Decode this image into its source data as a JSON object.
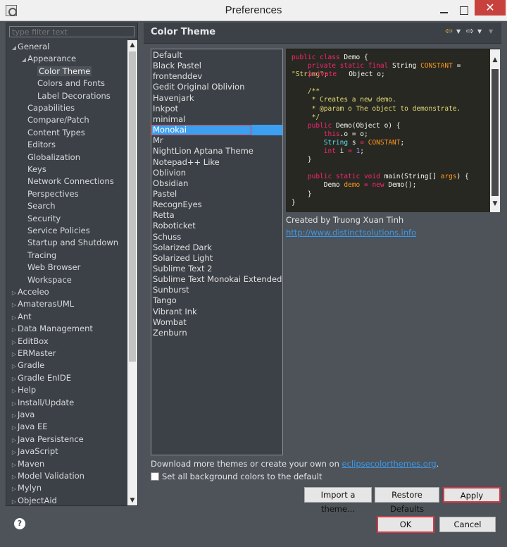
{
  "window": {
    "title": "Preferences",
    "close_glyph": "✕"
  },
  "tree": {
    "filter_placeholder": "type filter text",
    "items": [
      {
        "label": "General",
        "level": 0,
        "expanded": true
      },
      {
        "label": "Appearance",
        "level": 1,
        "expanded": true
      },
      {
        "label": "Color Theme",
        "level": 2,
        "selected": true
      },
      {
        "label": "Colors and Fonts",
        "level": 2
      },
      {
        "label": "Label Decorations",
        "level": 2
      },
      {
        "label": "Capabilities",
        "level": 1
      },
      {
        "label": "Compare/Patch",
        "level": 1
      },
      {
        "label": "Content Types",
        "level": 1
      },
      {
        "label": "Editors",
        "level": 1
      },
      {
        "label": "Globalization",
        "level": 1
      },
      {
        "label": "Keys",
        "level": 1
      },
      {
        "label": "Network Connections",
        "level": 1
      },
      {
        "label": "Perspectives",
        "level": 1
      },
      {
        "label": "Search",
        "level": 1
      },
      {
        "label": "Security",
        "level": 1
      },
      {
        "label": "Service Policies",
        "level": 1
      },
      {
        "label": "Startup and Shutdown",
        "level": 1
      },
      {
        "label": "Tracing",
        "level": 1
      },
      {
        "label": "Web Browser",
        "level": 1
      },
      {
        "label": "Workspace",
        "level": 1
      },
      {
        "label": "Acceleo",
        "level": 0
      },
      {
        "label": "AmaterasUML",
        "level": 0
      },
      {
        "label": "Ant",
        "level": 0
      },
      {
        "label": "Data Management",
        "level": 0
      },
      {
        "label": "EditBox",
        "level": 0
      },
      {
        "label": "ERMaster",
        "level": 0
      },
      {
        "label": "Gradle",
        "level": 0
      },
      {
        "label": "Gradle EnIDE",
        "level": 0
      },
      {
        "label": "Help",
        "level": 0
      },
      {
        "label": "Install/Update",
        "level": 0
      },
      {
        "label": "Java",
        "level": 0
      },
      {
        "label": "Java EE",
        "level": 0
      },
      {
        "label": "Java Persistence",
        "level": 0
      },
      {
        "label": "JavaScript",
        "level": 0
      },
      {
        "label": "Maven",
        "level": 0
      },
      {
        "label": "Model Validation",
        "level": 0
      },
      {
        "label": "Mylyn",
        "level": 0
      },
      {
        "label": "ObjectAid",
        "level": 0
      }
    ]
  },
  "content": {
    "title": "Color Theme",
    "themes": [
      "Default",
      "Black Pastel",
      "frontenddev",
      "Gedit Original Oblivion",
      "Havenjark",
      "Inkpot",
      "minimal",
      "Monokai",
      "Mr",
      "NightLion Aptana Theme",
      "Notepad++ Like",
      "Oblivion",
      "Obsidian",
      "Pastel",
      "RecognEyes",
      "Retta",
      "Roboticket",
      "Schuss",
      "Solarized Dark",
      "Solarized Light",
      "Sublime Text 2",
      "Sublime Text Monokai Extended",
      "Sunburst",
      "Tango",
      "Vibrant Ink",
      "Wombat",
      "Zenburn"
    ],
    "selected_theme": "Monokai",
    "preview_code": {
      "l1_kw": "public class",
      "l1_name": "Demo {",
      "l2_kw": "private static final",
      "l2_type": "String",
      "l2_const": "CONSTANT",
      "l2_eq": " =",
      "l3_str": "\"String\";",
      "l3_overlap": "private",
      "l3_rest": " Object o;",
      "c1": "/**",
      "c2": " * Creates a new demo.",
      "c3": " * @param o The object to demonstrate.",
      "c4": " */",
      "l8_kw": "public",
      "l8_rest": " Demo(Object o) {",
      "l9_kw": "this",
      "l9_rest": ".o = o;",
      "l10_type": "String",
      "l10_var": " s",
      "l10_eq": " = ",
      "l10_const": "CONSTANT",
      "l10_end": ";",
      "l11_kw": "int",
      "l11_var": " i",
      "l11_eq": " = ",
      "l11_num": "1",
      "l11_end": ";",
      "l12": "}",
      "l14_kw": "public static void",
      "l14_rest": " main(String[] ",
      "l14_arg": "args",
      "l14_end": ") {",
      "l15_name": "Demo",
      "l15_var": " demo",
      "l15_eq": " = ",
      "l15_kw": "new",
      "l15_rest": " Demo();",
      "l16": "}",
      "l17": "}"
    },
    "author": "Created by Truong Xuan Tinh",
    "author_link": "http://www.distinctsolutions.info",
    "download_prefix": "Download more themes or create your own on ",
    "download_link": "eclipsecolorthemes.org",
    "download_suffix": ".",
    "bg_checkbox_label": "Set all background colors to the default",
    "bg_checkbox_checked": false
  },
  "buttons": {
    "import": "Import a theme...",
    "restore": "Restore Defaults",
    "apply": "Apply",
    "ok": "OK",
    "cancel": "Cancel"
  },
  "icons": {
    "back": "back-arrow-icon",
    "forward": "forward-arrow-icon",
    "help": "help-icon"
  },
  "colors": {
    "accent_selection": "#3d9ff0",
    "highlight_border": "#d23b48",
    "panel_bg": "#3c4147",
    "editor_bg": "#272822"
  }
}
